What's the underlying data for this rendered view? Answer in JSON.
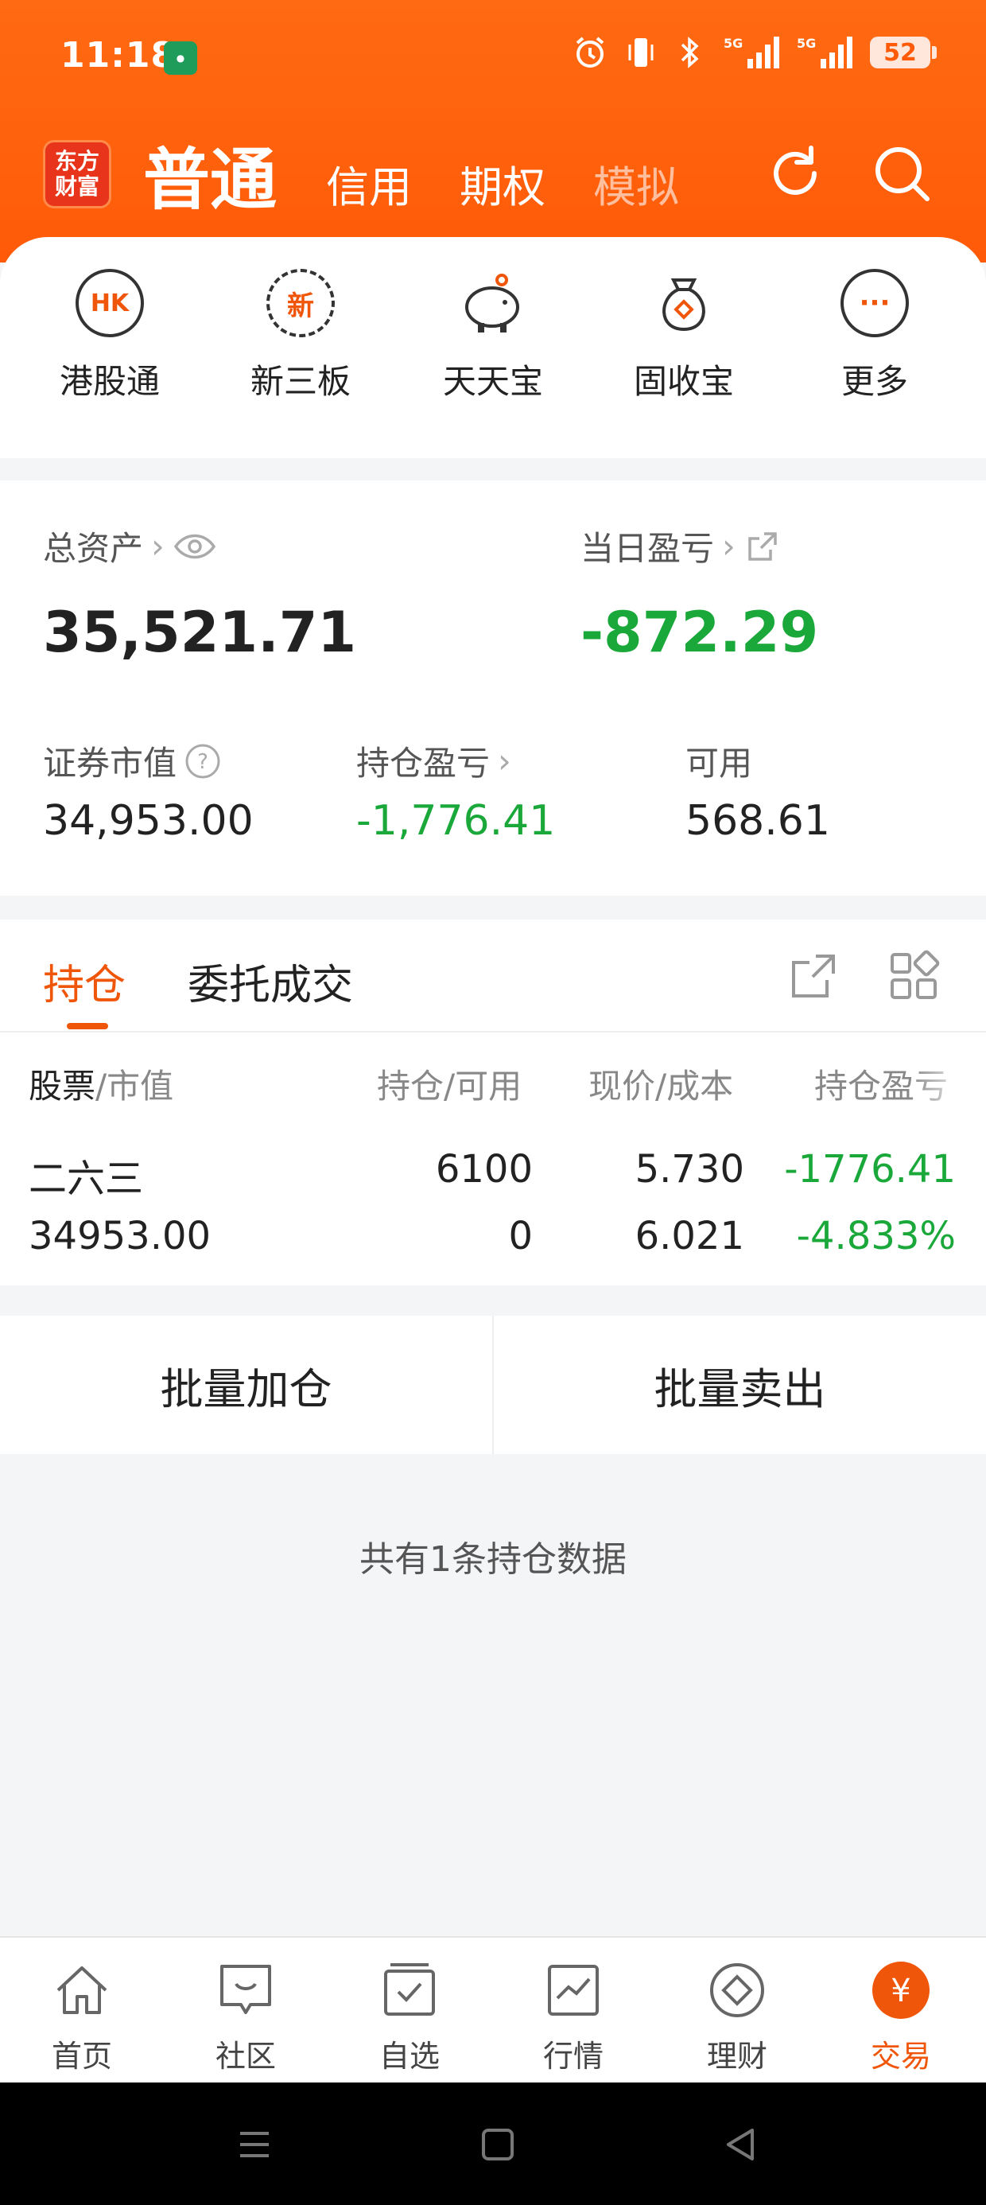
{
  "status_bar": {
    "time": "11:18",
    "battery": "52",
    "icons": [
      "alarm-icon",
      "vibrate-icon",
      "bluetooth-icon",
      "signal-5g-icon",
      "signal-5g-icon",
      "battery-icon"
    ]
  },
  "header": {
    "logo_line1": "东方",
    "logo_line2": "财富",
    "tabs": [
      {
        "label": "普通",
        "active": true
      },
      {
        "label": "信用",
        "active": false
      },
      {
        "label": "期权",
        "active": false
      },
      {
        "label": "模拟",
        "active": false
      }
    ],
    "actions": [
      "refresh-icon",
      "search-icon"
    ]
  },
  "quick_access": [
    {
      "label": "港股通",
      "icon_text": "HK",
      "icon": "hk-icon"
    },
    {
      "label": "新三板",
      "icon_text": "新",
      "icon": "new-board-icon"
    },
    {
      "label": "天天宝",
      "icon_text": "",
      "icon": "piggy-bank-icon"
    },
    {
      "label": "固收宝",
      "icon_text": "",
      "icon": "money-bag-icon"
    },
    {
      "label": "更多",
      "icon_text": "···",
      "icon": "more-icon"
    }
  ],
  "assets": {
    "total_label": "总资产",
    "total_value": "35,521.71",
    "daily_pnl_label": "当日盈亏",
    "daily_pnl_value": "-872.29",
    "market_value_label": "证券市值",
    "market_value": "34,953.00",
    "position_pnl_label": "持仓盈亏",
    "position_pnl_value": "-1,776.41",
    "available_label": "可用",
    "available_value": "568.61"
  },
  "positions": {
    "tabs": [
      "持仓",
      "委托成交"
    ],
    "columns": {
      "stock_a": "股票",
      "stock_b": "/市值",
      "qty": "持仓/可用",
      "price": "现价/成本",
      "pnl": "持仓盈亏"
    },
    "rows": [
      {
        "name": "二六三",
        "market_value": "34953.00",
        "holding": "6100",
        "available": "0",
        "price": "5.730",
        "cost": "6.021",
        "pnl": "-1776.41",
        "pnl_pct": "-4.833%"
      }
    ]
  },
  "batch": {
    "add_label": "批量加仓",
    "sell_label": "批量卖出"
  },
  "summary_text": "共有1条持仓数据",
  "bottom_nav": [
    {
      "label": "首页",
      "icon": "home-icon",
      "active": false
    },
    {
      "label": "社区",
      "icon": "community-icon",
      "active": false
    },
    {
      "label": "自选",
      "icon": "watchlist-icon",
      "active": false
    },
    {
      "label": "行情",
      "icon": "market-icon",
      "active": false
    },
    {
      "label": "理财",
      "icon": "wealth-icon",
      "active": false
    },
    {
      "label": "交易",
      "icon": "trade-icon",
      "active": true
    }
  ],
  "colors": {
    "brand": "#ff5a08",
    "accent": "#f0560a",
    "loss": "#1aa83a"
  }
}
